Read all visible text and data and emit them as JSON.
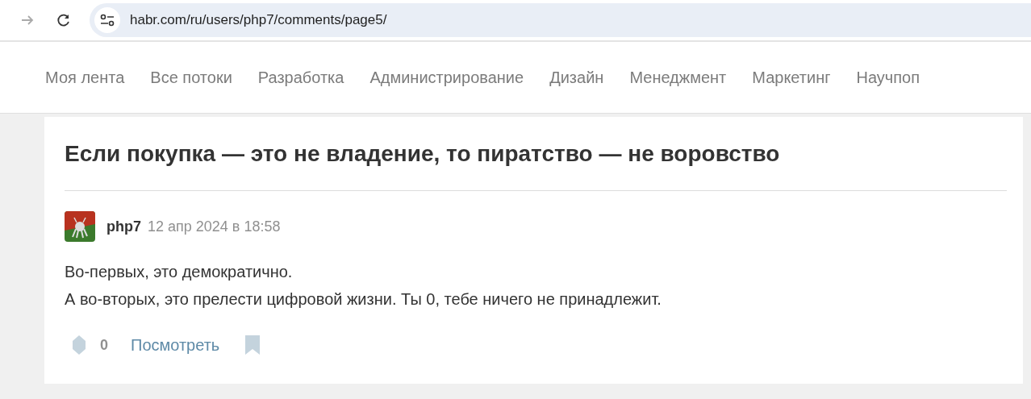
{
  "browser": {
    "url": "habr.com/ru/users/php7/comments/page5/"
  },
  "nav": [
    {
      "label": "Моя лента"
    },
    {
      "label": "Все потоки"
    },
    {
      "label": "Разработка"
    },
    {
      "label": "Администрирование"
    },
    {
      "label": "Дизайн"
    },
    {
      "label": "Менеджмент"
    },
    {
      "label": "Маркетинг"
    },
    {
      "label": "Научпоп"
    }
  ],
  "article": {
    "title": "Если покупка — это не владение, то пиратство — не воровство"
  },
  "comment": {
    "author": "php7",
    "date": "12 апр 2024 в 18:58",
    "lines": [
      "Во-первых, это демократично.",
      "А во-вторых, это прелести цифровой жизни. Ты 0, тебе ничего не принадлежит."
    ],
    "score": "0",
    "view_link": "Посмотреть"
  }
}
